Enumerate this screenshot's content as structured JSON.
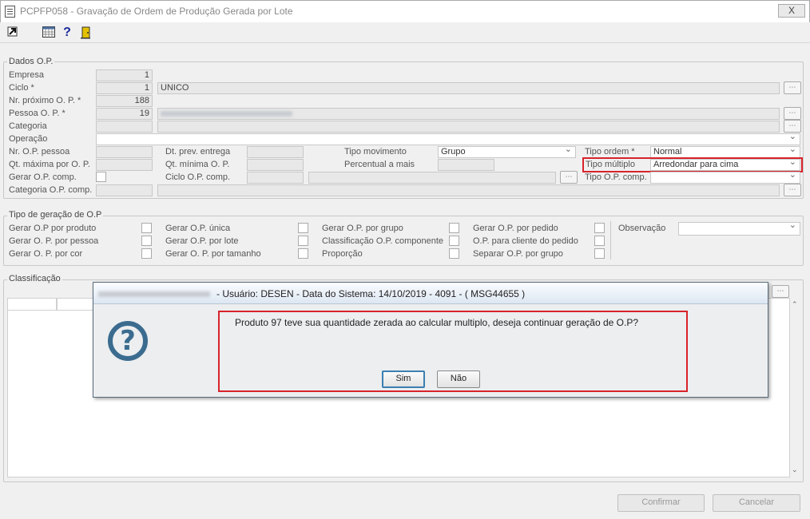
{
  "window": {
    "title": "PCPFP058 - Gravação de Ordem de Produção Gerada por Lote",
    "close": "X"
  },
  "toolbar": {
    "icons": [
      "exit-icon",
      "calendar-grid-icon",
      "help-icon",
      "door-icon"
    ],
    "help_glyph": "?"
  },
  "dados": {
    "title": "Dados O.P.",
    "empresa_label": "Empresa",
    "empresa_value": "1",
    "ciclo_label": "Ciclo *",
    "ciclo_value": "1",
    "ciclo_desc": "UNICO",
    "nr_proximo_label": "Nr. próximo O. P. *",
    "nr_proximo_value": "188",
    "pessoa_label": "Pessoa O. P. *",
    "pessoa_value": "19",
    "categoria_label": "Categoria",
    "operacao_label": "Operação",
    "nr_op_pessoa_label": "Nr. O.P. pessoa",
    "dt_prev_label": "Dt. prev. entrega",
    "tipo_mov_label": "Tipo movimento",
    "tipo_mov_value": "Grupo",
    "tipo_ordem_label": "Tipo ordem *",
    "tipo_ordem_value": "Normal",
    "qt_max_label": "Qt. máxima por O. P.",
    "qt_min_label": "Qt. mínima O. P.",
    "percentual_label": "Percentual a mais",
    "tipo_multiplo_label": "Tipo múltiplo",
    "tipo_multiplo_value": "Arredondar para cima",
    "gerar_comp_label": "Gerar O.P. comp.",
    "ciclo_comp_label": "Ciclo O.P. comp.",
    "tipo_op_comp_label": "Tipo O.P. comp.",
    "categoria_comp_label": "Categoria O.P. comp."
  },
  "tipo_geracao": {
    "title": "Tipo de geração de O.P",
    "col1": [
      "Gerar O.P por produto",
      "Gerar O. P. por pessoa",
      "Gerar O. P. por cor"
    ],
    "col2": [
      "Gerar O.P. única",
      "Gerar O.P. por lote",
      "Gerar O. P. por tamanho"
    ],
    "col3": [
      "Gerar O.P. por grupo",
      "Classificação O.P. componente",
      "Proporção"
    ],
    "col4": [
      "Gerar O.P. por pedido",
      "O.P. para cliente do pedido",
      "Separar  O.P. por grupo"
    ],
    "observacao_label": "Observação"
  },
  "classificacao": {
    "title": "Classificação"
  },
  "dialog": {
    "title": "- Usuário: DESEN - Data do Sistema: 14/10/2019 - 4091 - ( MSG44655 )",
    "message": "Produto 97 teve sua quantidade zerada ao calcular multiplo, deseja continuar geração de O.P?",
    "icon_glyph": "?",
    "yes_label": "Sim",
    "no_label": "Não"
  },
  "footer": {
    "confirm_label": "Confirmar",
    "cancel_label": "Cancelar"
  },
  "colors": {
    "highlight": "#d8232a",
    "accent": "#3b6c8f"
  }
}
